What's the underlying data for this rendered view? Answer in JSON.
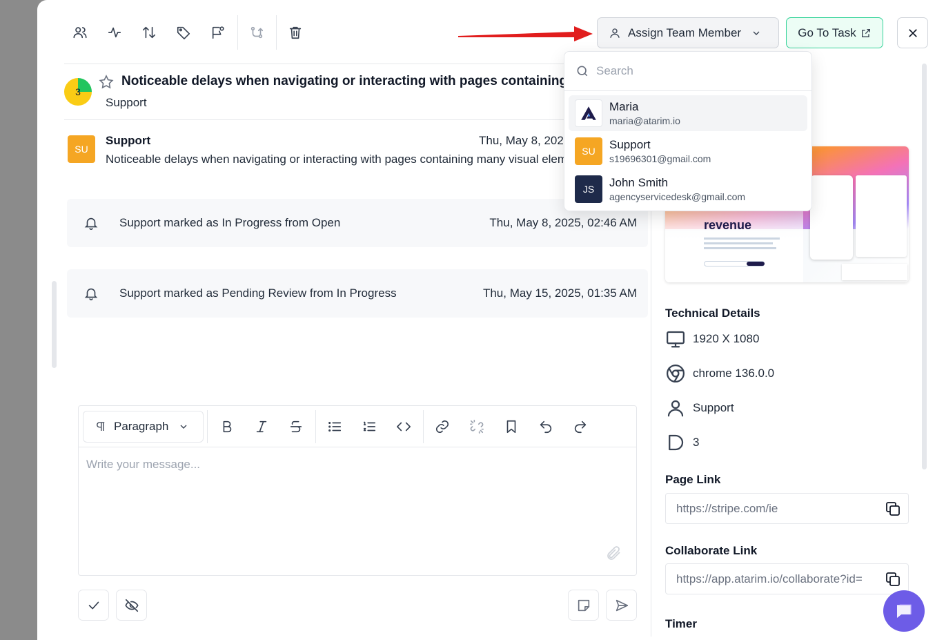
{
  "header": {
    "assign_label": "Assign Team Member",
    "goto_label": "Go To Task"
  },
  "task": {
    "progress": "3",
    "title": "Noticeable delays when navigating or interacting with pages containing",
    "subtitle": "Support"
  },
  "message": {
    "avatar_initials": "SU",
    "author": "Support",
    "date": "Thu, May 8, 2025",
    "text": "Noticeable delays when navigating or interacting with pages containing many visual elements"
  },
  "activity": [
    {
      "text": "Support marked as In Progress from Open",
      "date": "Thu, May 8, 2025, 02:46 AM"
    },
    {
      "text": "Support marked as Pending Review from In Progress",
      "date": "Thu, May 15, 2025, 01:35 AM"
    }
  ],
  "editor": {
    "format_label": "Paragraph",
    "placeholder": "Write your message..."
  },
  "dropdown": {
    "search_placeholder": "Search",
    "members": [
      {
        "name": "Maria",
        "email": "maria@atarim.io",
        "initials": "",
        "avatar_color": "#ffffff"
      },
      {
        "name": "Support",
        "email": "s19696301@gmail.com",
        "initials": "SU",
        "avatar_color": "#f5a623"
      },
      {
        "name": "John Smith",
        "email": "agencyservicedesk@gmail.com",
        "initials": "JS",
        "avatar_color": "#1e2a4a"
      }
    ]
  },
  "details": {
    "technical_title": "Technical Details",
    "resolution": "1920 X 1080",
    "browser": "chrome 136.0.0",
    "user": "Support",
    "count": "3",
    "page_link_title": "Page Link",
    "page_link": "https://stripe.com/ie",
    "collab_link_title": "Collaborate Link",
    "collab_link": "https://app.atarim.io/collaborate?id=",
    "timer_title": "Timer",
    "thumb_text": "revenue"
  },
  "colors": {
    "accent": "#34d399",
    "chat": "#6d5ce7",
    "arrow": "#e11d1d"
  }
}
